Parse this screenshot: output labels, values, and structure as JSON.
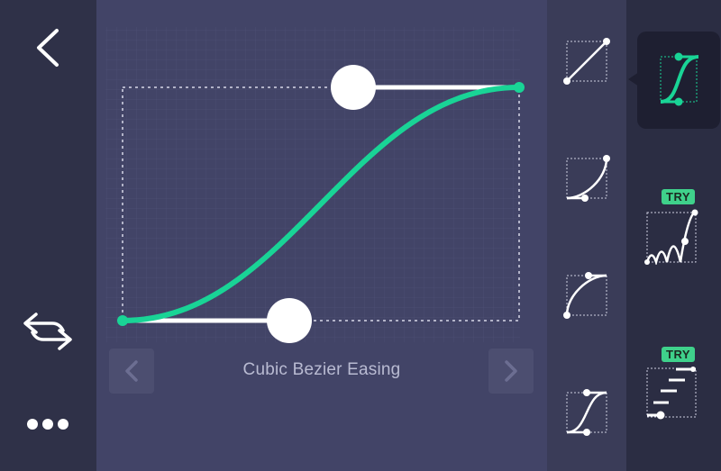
{
  "left_sidebar": {
    "back_icon": "chevron-left-icon",
    "swap_icon": "swap-arrows-icon",
    "more_icon": "more-dots-icon"
  },
  "editor": {
    "caption": "Cubic Bezier Easing",
    "prev_icon": "chevron-left-icon",
    "next_icon": "chevron-right-icon",
    "accent_color": "#19d496",
    "curve": {
      "control_point_1": [
        0.42,
        0.0
      ],
      "control_point_2": [
        0.58,
        1.0
      ]
    }
  },
  "presets": [
    {
      "name": "linear",
      "icon": "linear-curve-icon"
    },
    {
      "name": "ease-in",
      "icon": "ease-in-curve-icon"
    },
    {
      "name": "ease-out",
      "icon": "ease-out-curve-icon"
    },
    {
      "name": "ease-in-out",
      "icon": "ease-in-out-curve-icon"
    }
  ],
  "right_sidebar": {
    "items": [
      {
        "name": "cubic-bezier",
        "icon": "cubic-bezier-icon",
        "selected": true
      },
      {
        "name": "spring",
        "icon": "spring-bounce-icon",
        "badge": "TRY"
      },
      {
        "name": "steps",
        "icon": "steps-icon",
        "badge": "TRY"
      }
    ]
  }
}
